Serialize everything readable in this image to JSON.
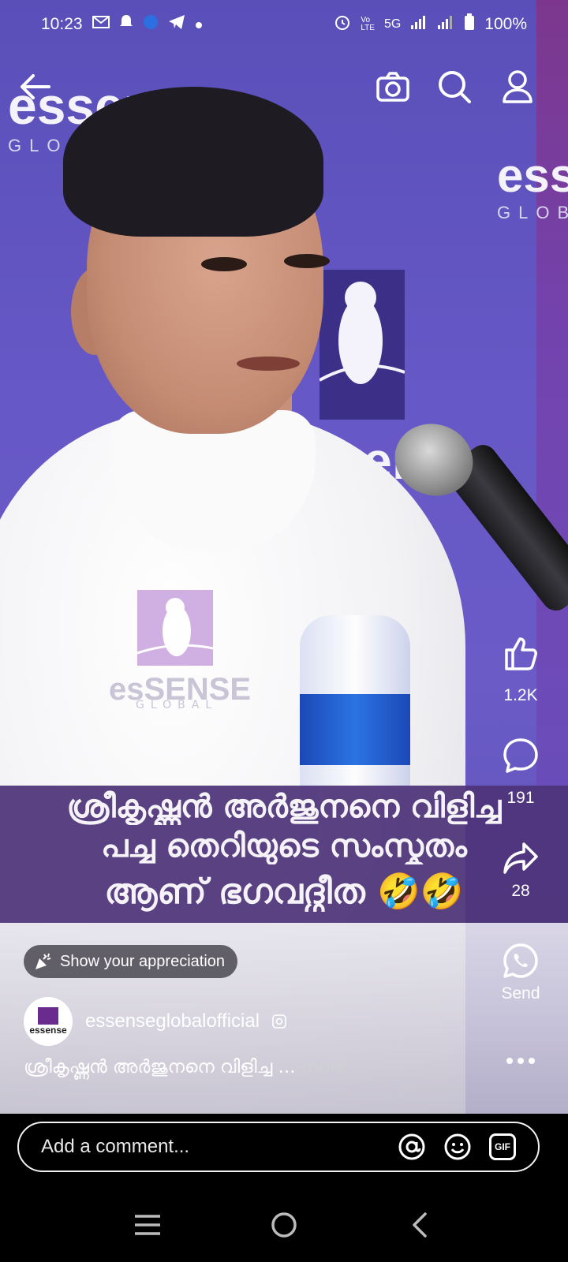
{
  "status_bar": {
    "time": "10:23",
    "network": "5G",
    "battery": "100%"
  },
  "video": {
    "background_logo_text": "essense",
    "background_logo_sub": "GLOBAL",
    "watermark_text": "esSENSE",
    "watermark_sub": "GLOBAL",
    "caption_lines": [
      "ശ്രീകൃഷ്ണൻ അർജുനനെ വിളിച്ച",
      "പച്ച തെറിയുടെ സംസ്കൃതം",
      "ആണ് ഭഗവദ്ഗീത 🤣🤣"
    ]
  },
  "right_rail": {
    "like_count": "1.2K",
    "comment_count": "191",
    "share_count": "28",
    "send_label": "Send"
  },
  "appreciation_label": "Show your appreciation",
  "author": {
    "name": "essenseglobalofficial",
    "avatar_text": "essense"
  },
  "description": {
    "text": "ശ്രീകൃഷ്ണൻ അർജുനനെ വിളിച്ച ...",
    "more_label": "more"
  },
  "comment": {
    "placeholder": "Add a comment...",
    "gif_label": "GIF"
  },
  "colors": {
    "backdrop": "#6658c6",
    "caption_band": "#4d3478",
    "shirt": "#f2f1f4"
  }
}
